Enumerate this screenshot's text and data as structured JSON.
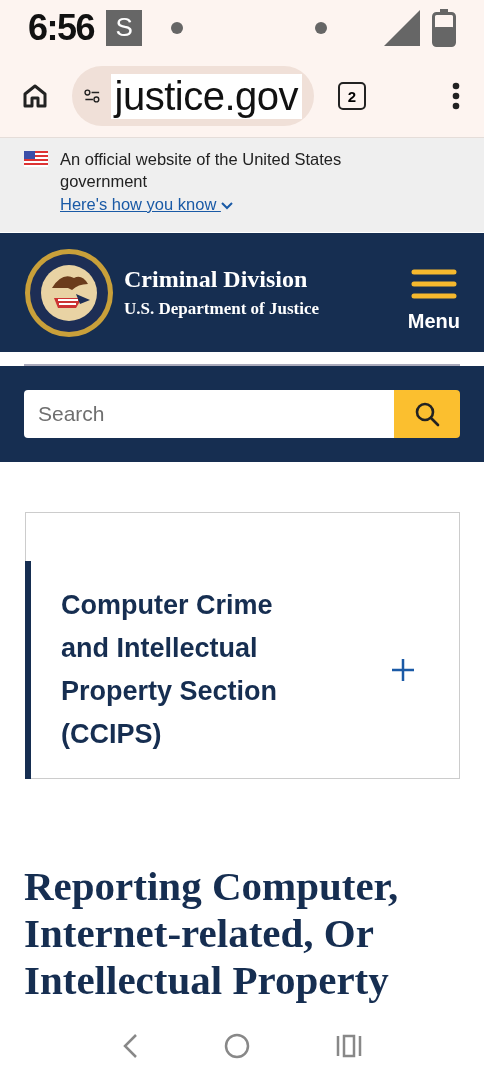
{
  "status_bar": {
    "time": "6:56",
    "badge": "S"
  },
  "browser": {
    "url": "justice.gov",
    "tab_count": "2"
  },
  "banner": {
    "text": "An official website of the United States government",
    "link": "Here's how you know",
    "expanded": false
  },
  "header": {
    "title": "Criminal Division",
    "subtitle": "U.S. Department of Justice",
    "menu_label": "Menu"
  },
  "search": {
    "placeholder": "Search"
  },
  "accordion": {
    "title": "Computer Crime and Intellectual Property Section (CCIPS)",
    "expanded": false
  },
  "page_heading": "Reporting Computer, Internet-related, Or Intellectual Property"
}
